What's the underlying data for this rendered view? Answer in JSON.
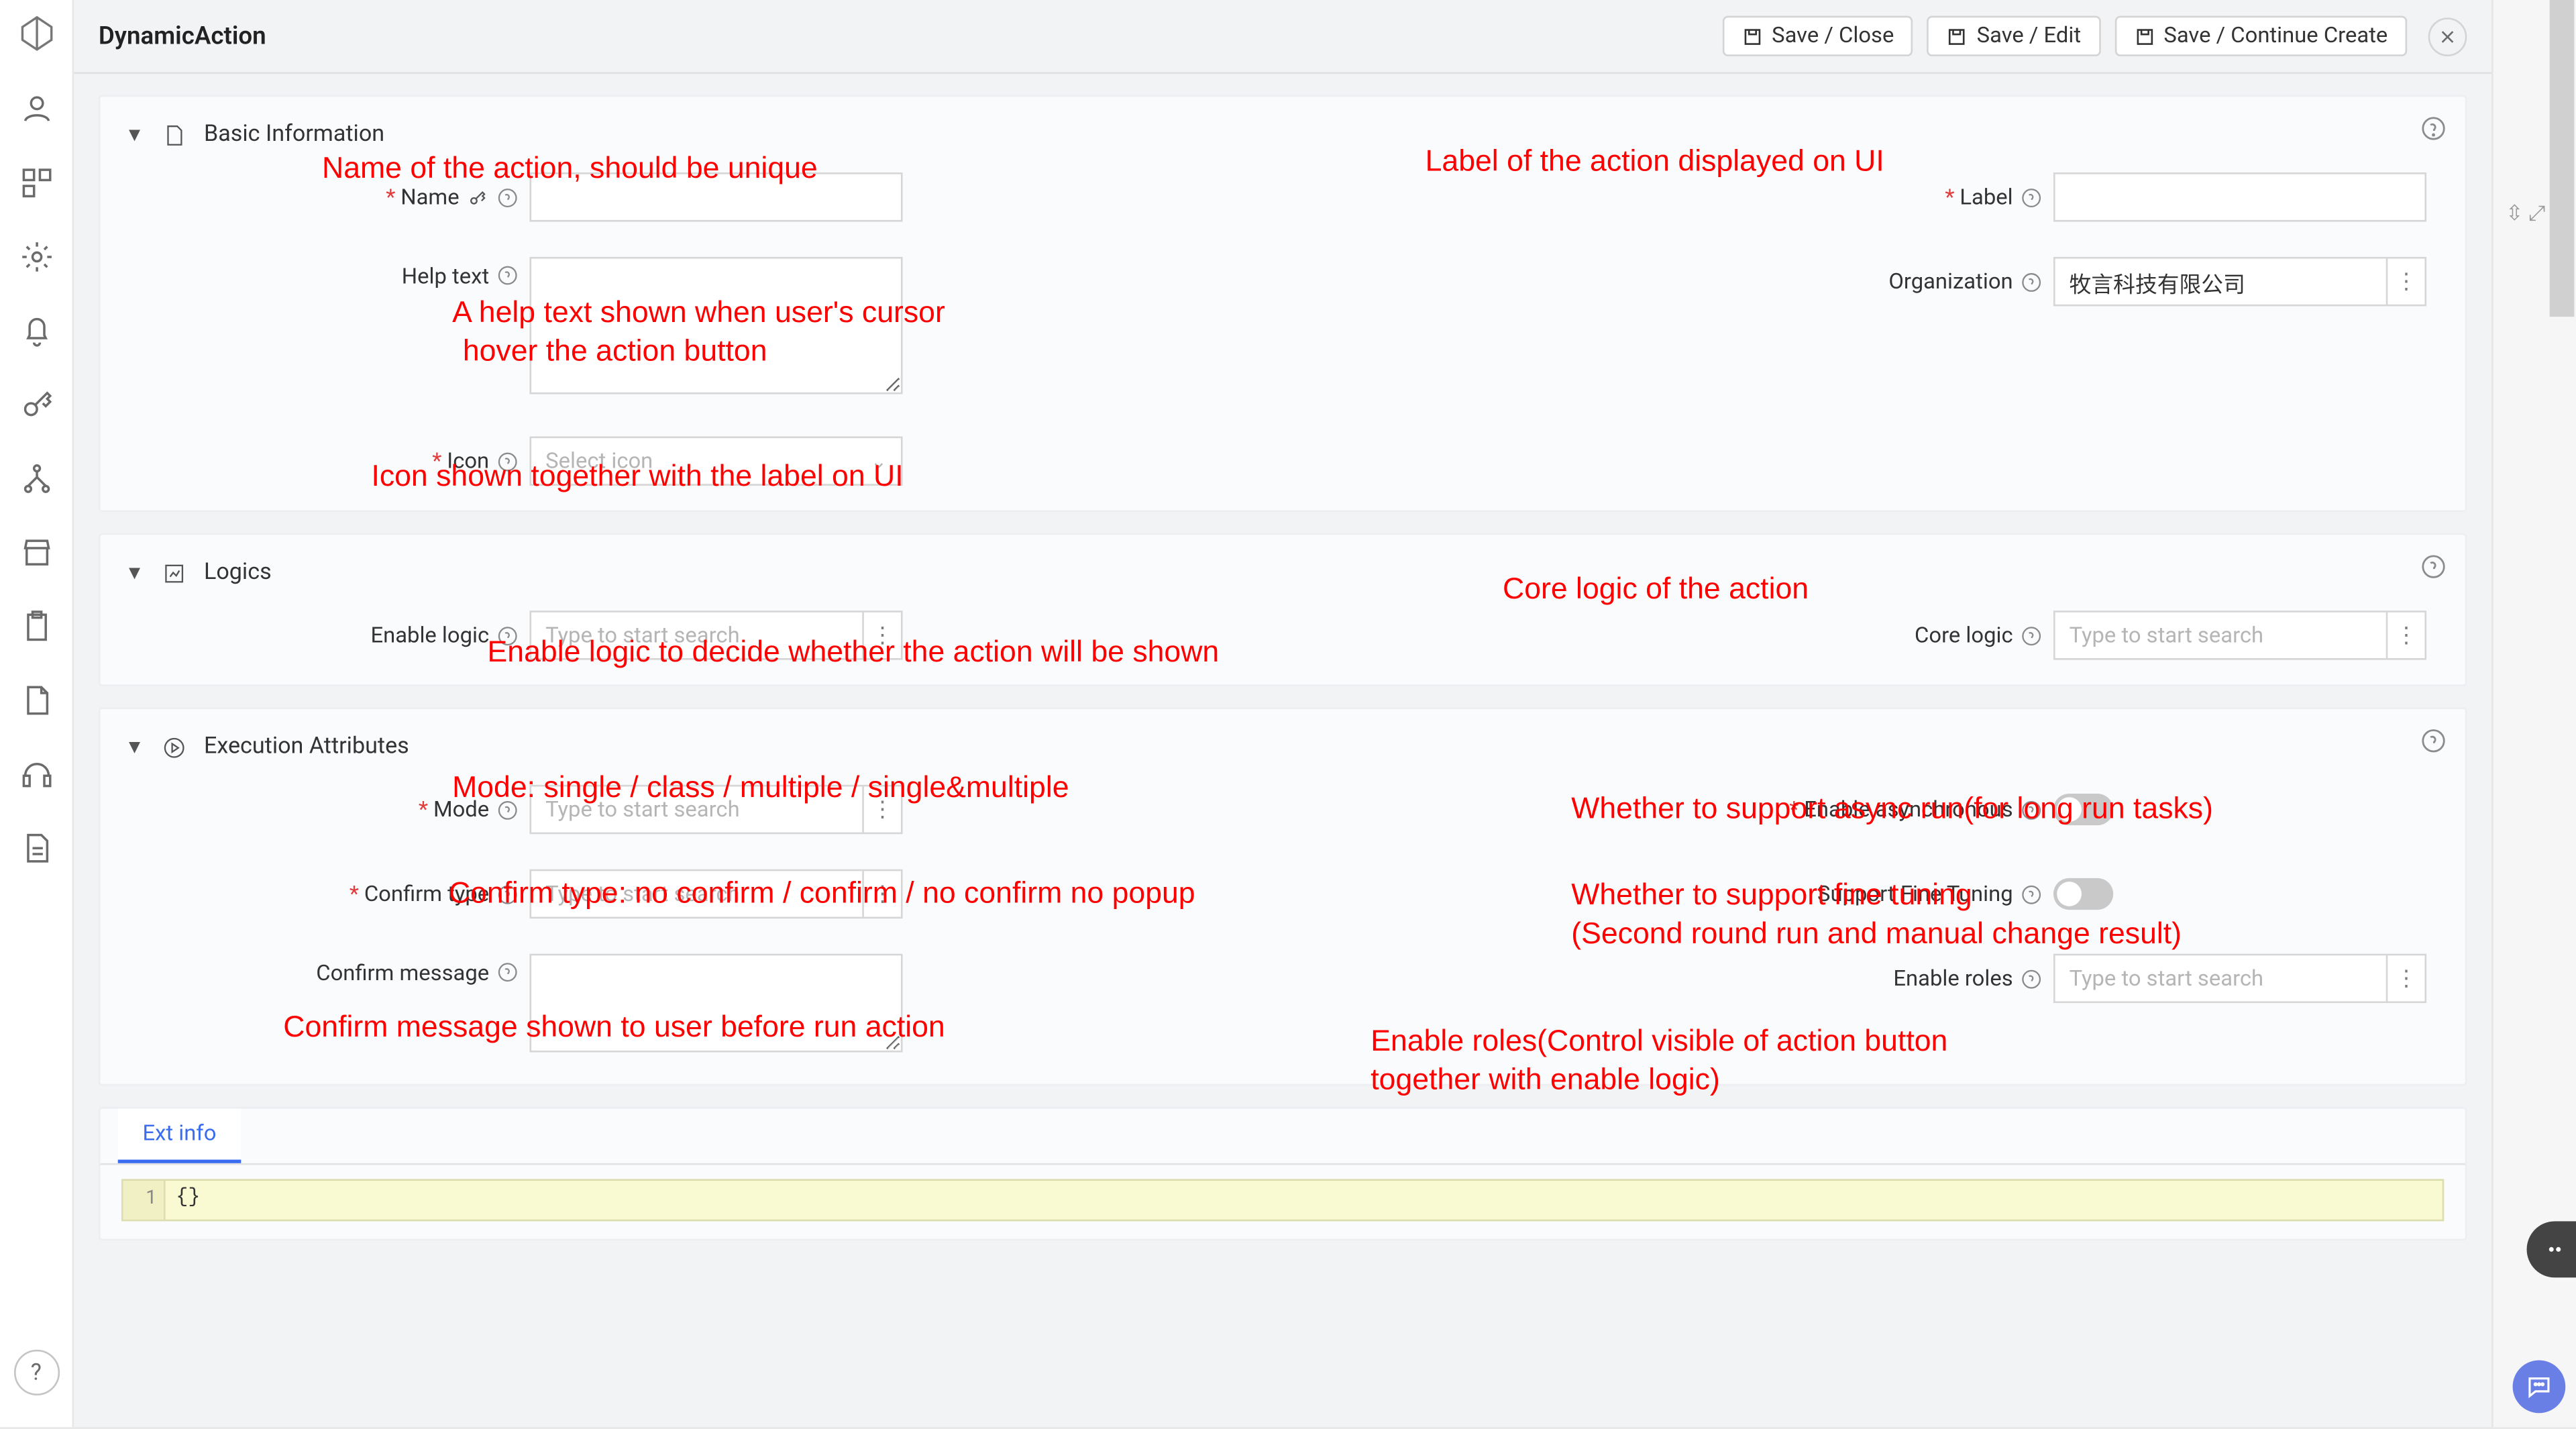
{
  "header": {
    "title": "DynamicAction",
    "btn_save_close": "Save / Close",
    "btn_save_edit": "Save / Edit",
    "btn_save_continue": "Save / Continue Create"
  },
  "sections": {
    "basic": "Basic Information",
    "logics": "Logics",
    "exec": "Execution Attributes"
  },
  "fields": {
    "name": "Name",
    "label": "Label",
    "helptext": "Help text",
    "organization": "Organization",
    "icon": "Icon",
    "icon_placeholder": "Select icon",
    "enable_logic": "Enable logic",
    "core_logic": "Core logic",
    "search_placeholder": "Type to start search",
    "mode": "Mode",
    "enable_async": "Enable asynchronous",
    "confirm_type": "Confirm type",
    "support_fine": "Support Fine Tuning",
    "confirm_message": "Confirm message",
    "enable_roles": "Enable roles"
  },
  "values": {
    "organization": "牧言科技有限公司"
  },
  "annotations": {
    "a_name": "Name of the action, should be unique",
    "a_label": "Label of the action displayed on UI",
    "a_help1": "A help text shown when user's cursor",
    "a_help2": "hover the action button",
    "a_icon": "Icon shown together with the label on UI",
    "a_enable_logic": "Enable logic to decide whether the action will be shown",
    "a_core_logic": "Core logic of the action",
    "a_mode": "Mode: single / class / multiple / single&multiple",
    "a_async": "Whether to support async run(for long run tasks)",
    "a_confirm_type": "Confirm type: no confirm / confirm / no confirm no popup",
    "a_fine1": "Whether to support fine tuning",
    "a_fine2": "(Second round run and manual change result)",
    "a_confirm_msg": "Confirm message shown to user before run action",
    "a_roles1": "Enable roles(Control visible of action button",
    "a_roles2": "together with enable logic)"
  },
  "tabs": {
    "ext_info": "Ext info"
  },
  "code": {
    "line1_no": "1",
    "line1_text": "{}"
  }
}
